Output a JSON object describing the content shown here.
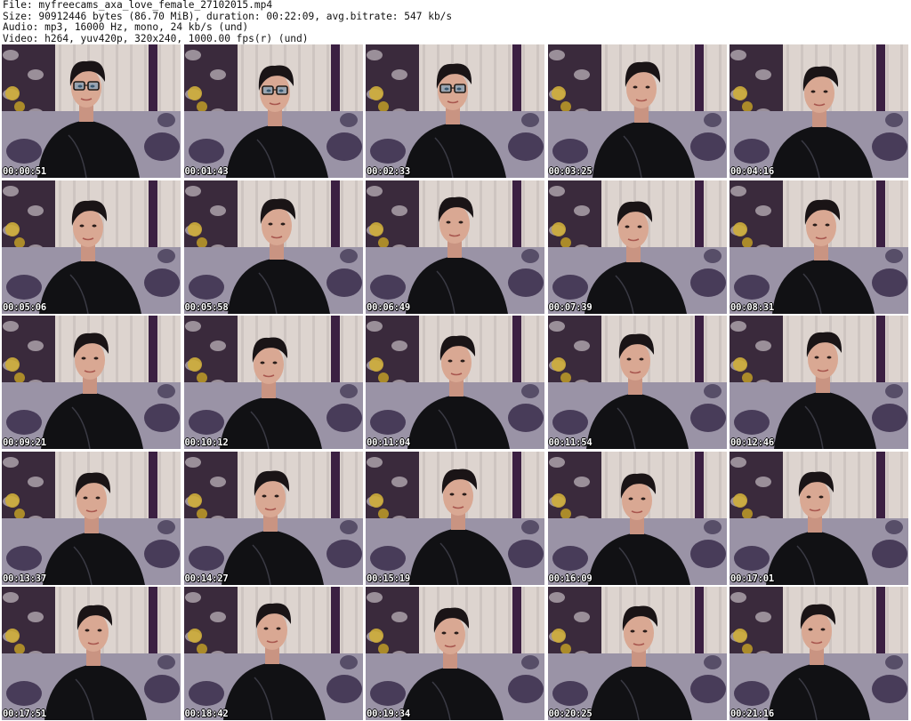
{
  "header": {
    "file_line": "File: myfreecams_axa_love_female_27102015.mp4",
    "size_line": "Size: 90912446 bytes (86.70 MiB), duration: 00:22:09, avg.bitrate: 547 kb/s",
    "audio_line": "Audio: mp3, 16000 Hz, mono, 24 kb/s (und)",
    "video_line": "Video: h264, yuv420p, 320x240, 1000.00 fps(r) (und)"
  },
  "thumbnails": [
    {
      "timestamp": "00:00:51",
      "glasses": true
    },
    {
      "timestamp": "00:01:43",
      "glasses": true
    },
    {
      "timestamp": "00:02:33",
      "glasses": true
    },
    {
      "timestamp": "00:03:25",
      "glasses": false
    },
    {
      "timestamp": "00:04:16",
      "glasses": false
    },
    {
      "timestamp": "00:05:06",
      "glasses": false
    },
    {
      "timestamp": "00:05:58",
      "glasses": false
    },
    {
      "timestamp": "00:06:49",
      "glasses": false
    },
    {
      "timestamp": "00:07:39",
      "glasses": false
    },
    {
      "timestamp": "00:08:31",
      "glasses": false
    },
    {
      "timestamp": "00:09:21",
      "glasses": false
    },
    {
      "timestamp": "00:10:12",
      "glasses": false
    },
    {
      "timestamp": "00:11:04",
      "glasses": false
    },
    {
      "timestamp": "00:11:54",
      "glasses": false
    },
    {
      "timestamp": "00:12:46",
      "glasses": false
    },
    {
      "timestamp": "00:13:37",
      "glasses": false
    },
    {
      "timestamp": "00:14:27",
      "glasses": false
    },
    {
      "timestamp": "00:15:19",
      "glasses": false
    },
    {
      "timestamp": "00:16:09",
      "glasses": false
    },
    {
      "timestamp": "00:17:01",
      "glasses": false
    },
    {
      "timestamp": "00:17:51",
      "glasses": false
    },
    {
      "timestamp": "00:18:42",
      "glasses": false
    },
    {
      "timestamp": "00:19:34",
      "glasses": false
    },
    {
      "timestamp": "00:20:25",
      "glasses": false
    },
    {
      "timestamp": "00:21:16",
      "glasses": false
    }
  ],
  "colors": {
    "curtain": "#ddd4cf",
    "wall_pattern": "#3a2a3c",
    "sofa": "#9a93a6",
    "flower_dark": "#2c1f3f",
    "jacket": "#111114",
    "skin": "#d9a893",
    "hair": "#1a1416",
    "timestamp_text": "#ffffff",
    "header_text": "#111111"
  }
}
